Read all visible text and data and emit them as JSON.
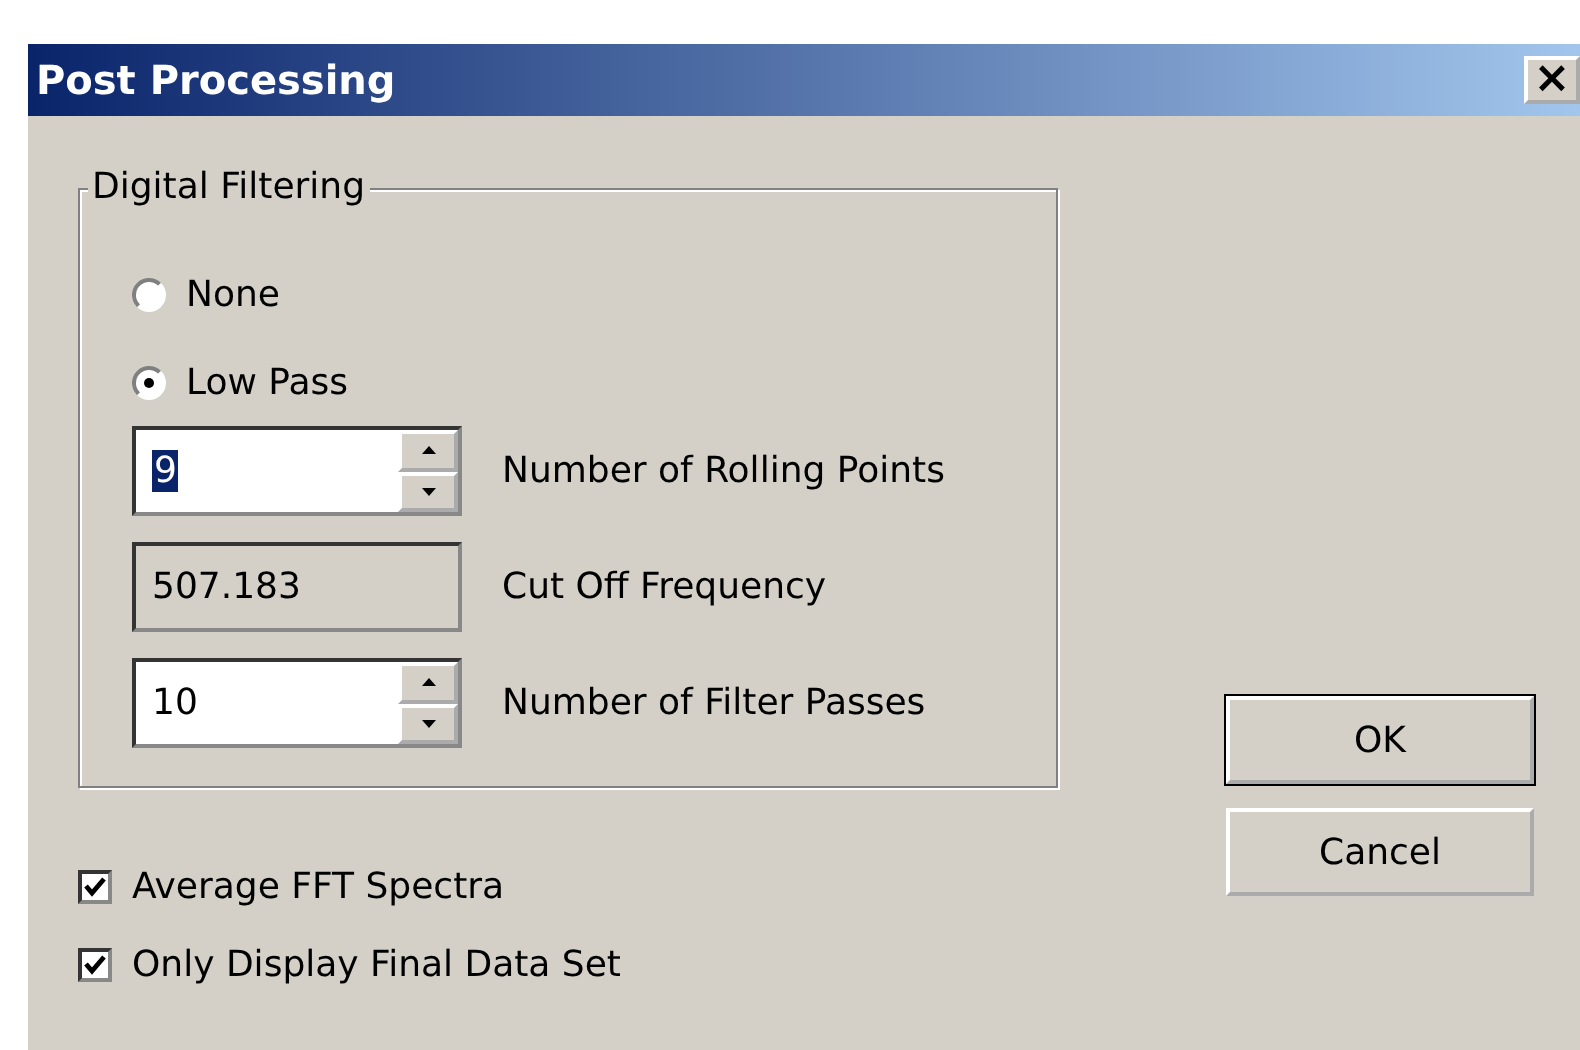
{
  "window": {
    "title": "Post Processing",
    "close": "×"
  },
  "group": {
    "title": "Digital Filtering",
    "radios": [
      {
        "label": "None",
        "selected": false
      },
      {
        "label": "Low Pass",
        "selected": true
      }
    ],
    "fields": [
      {
        "kind": "spin",
        "value": "9",
        "text_selected": true,
        "label": "Number of Rolling Points"
      },
      {
        "kind": "readonly",
        "value": "507.183",
        "text_selected": false,
        "label": "Cut Off Frequency"
      },
      {
        "kind": "spin",
        "value": "10",
        "text_selected": false,
        "label": "Number of Filter Passes"
      }
    ]
  },
  "checkboxes": [
    {
      "label": "Average FFT Spectra",
      "checked": true
    },
    {
      "label": "Only Display Final Data Set",
      "checked": true
    }
  ],
  "buttons": [
    {
      "label": "OK",
      "default": true
    },
    {
      "label": "Cancel",
      "default": false
    }
  ]
}
